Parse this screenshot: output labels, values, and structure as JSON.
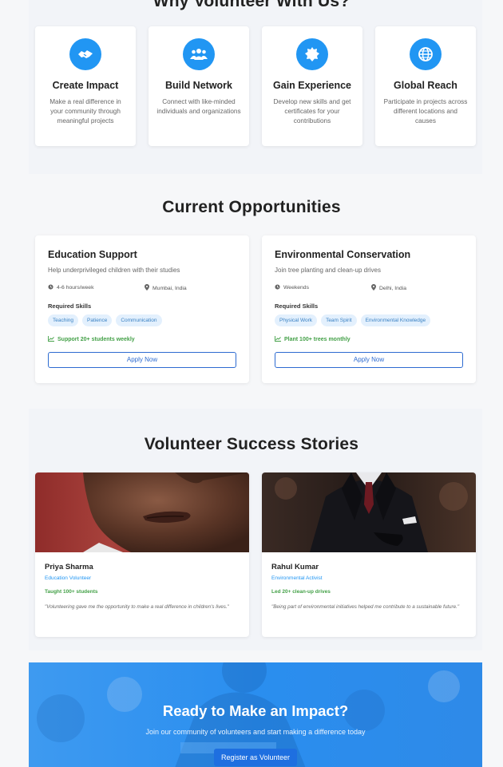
{
  "why": {
    "title": "Why Volunteer With Us?",
    "features": [
      {
        "icon": "handshake-icon",
        "title": "Create Impact",
        "desc": "Make a real difference in your community through meaningful projects"
      },
      {
        "icon": "users-icon",
        "title": "Build Network",
        "desc": "Connect with like-minded individuals and organizations"
      },
      {
        "icon": "certificate-icon",
        "title": "Gain Experience",
        "desc": "Develop new skills and get certificates for your contributions"
      },
      {
        "icon": "globe-icon",
        "title": "Global Reach",
        "desc": "Participate in projects across different locations and causes"
      }
    ]
  },
  "opportunities": {
    "title": "Current Opportunities",
    "skills_label": "Required Skills",
    "apply_label": "Apply Now",
    "items": [
      {
        "title": "Education Support",
        "desc": "Help underprivileged children with their studies",
        "time": "4-6 hours/week",
        "location": "Mumbai, India",
        "skills": [
          "Teaching",
          "Patience",
          "Communication"
        ],
        "impact": "Support 20+ students weekly"
      },
      {
        "title": "Environmental Conservation",
        "desc": "Join tree planting and clean-up drives",
        "time": "Weekends",
        "location": "Delhi, India",
        "skills": [
          "Physical Work",
          "Team Spirit",
          "Environmental Knowledge"
        ],
        "impact": "Plant 100+ trees monthly"
      }
    ]
  },
  "stories": {
    "title": "Volunteer Success Stories",
    "items": [
      {
        "name": "Priya Sharma",
        "role": "Education Volunteer",
        "impact": "Taught 100+ students",
        "quote": "\"Volunteering gave me the opportunity to make a real difference in children's lives.\""
      },
      {
        "name": "Rahul Kumar",
        "role": "Environmental Activist",
        "impact": "Led 20+ clean-up drives",
        "quote": "\"Being part of environmental initiatives helped me contribute to a sustainable future.\""
      }
    ]
  },
  "cta": {
    "title": "Ready to Make an Impact?",
    "subtitle": "Join our community of volunteers and start making a difference today",
    "button": "Register as Volunteer"
  },
  "colors": {
    "accent": "#2196f3",
    "success": "#43a047",
    "tag_bg": "#e3f0fd",
    "button_border": "#2d6bd1"
  }
}
